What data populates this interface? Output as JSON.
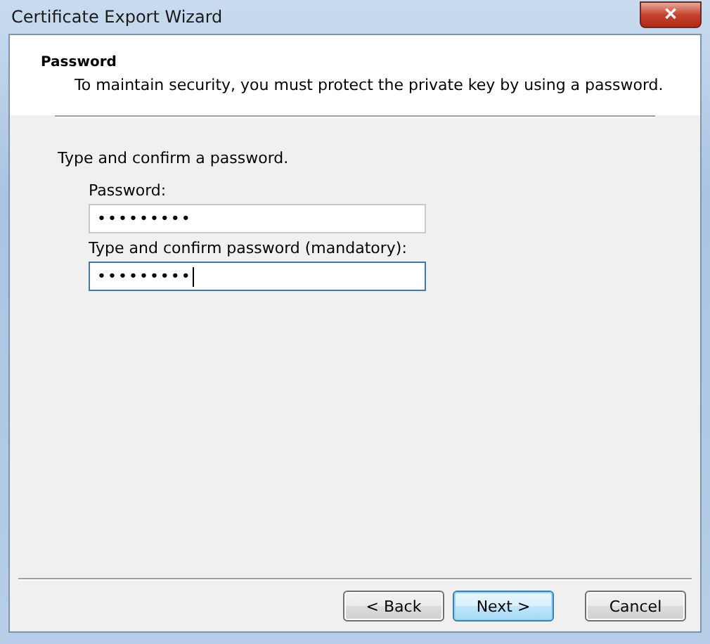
{
  "window": {
    "title": "Certificate Export Wizard",
    "close_label": "✕"
  },
  "header": {
    "title": "Password",
    "description": "To maintain security, you must protect the private key by using a password."
  },
  "body": {
    "instruction": "Type and confirm a password.",
    "fields": [
      {
        "label": "Password:",
        "value": "•••••••••",
        "focused": false
      },
      {
        "label": "Type and confirm password (mandatory):",
        "value": "•••••••••",
        "focused": true
      }
    ]
  },
  "buttons": [
    {
      "label": "< Back",
      "default": false
    },
    {
      "label": "Next >",
      "default": true
    },
    {
      "label": "Cancel",
      "default": false
    }
  ]
}
